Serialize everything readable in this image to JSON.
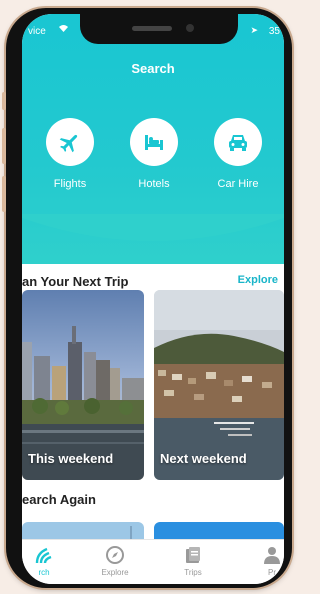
{
  "status_bar": {
    "carrier": "vice",
    "battery": "35"
  },
  "header": {
    "title": "Search"
  },
  "quick_actions": [
    {
      "label": "Flights",
      "icon": "plane-icon"
    },
    {
      "label": "Hotels",
      "icon": "bed-icon"
    },
    {
      "label": "Car Hire",
      "icon": "car-icon"
    }
  ],
  "plan_section": {
    "title": "an Your Next Trip",
    "explore_label": "Explore"
  },
  "trip_cards": [
    {
      "label": "This weekend"
    },
    {
      "label": "Next weekend"
    }
  ],
  "search_again": {
    "title": "earch Again"
  },
  "tabbar": [
    {
      "label": "rch",
      "icon": "search-waves-icon",
      "active": true
    },
    {
      "label": "Explore",
      "icon": "compass-icon",
      "active": false
    },
    {
      "label": "Trips",
      "icon": "trips-icon",
      "active": false
    },
    {
      "label": "Pr",
      "icon": "profile-icon",
      "active": false
    }
  ],
  "colors": {
    "accent": "#19c6d2",
    "link": "#19b5c9",
    "tab_inactive": "#999999"
  }
}
